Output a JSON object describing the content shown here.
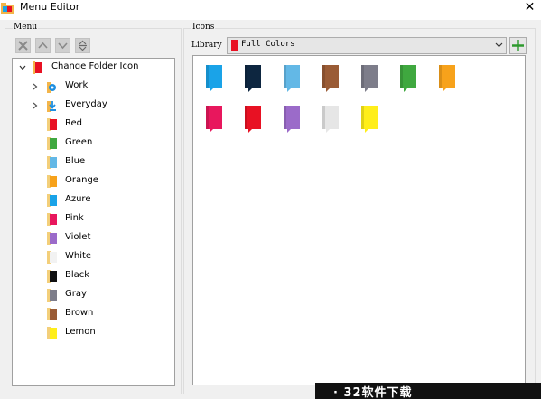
{
  "window": {
    "title": "Menu Editor",
    "close_glyph": "✕"
  },
  "menu_group": {
    "label": "Menu"
  },
  "icons_group": {
    "label": "Icons"
  },
  "toolbar": {
    "icons": [
      "delete-icon",
      "move-up-icon",
      "move-down-icon",
      "reorder-icon"
    ]
  },
  "tree": {
    "root": {
      "label": "Change Folder Icon",
      "color": "#e81123"
    },
    "items": [
      {
        "label": "Work",
        "icon": "gear-icon",
        "expandable": true
      },
      {
        "label": "Everyday",
        "icon": "download-icon",
        "expandable": true
      },
      {
        "label": "Red",
        "color": "#e81123"
      },
      {
        "label": "Green",
        "color": "#3fa83f"
      },
      {
        "label": "Blue",
        "color": "#63b8e6"
      },
      {
        "label": "Orange",
        "color": "#f7a21b"
      },
      {
        "label": "Azure",
        "color": "#1aa3e8"
      },
      {
        "label": "Pink",
        "color": "#e8175d"
      },
      {
        "label": "Violet",
        "color": "#9b6bc9"
      },
      {
        "label": "White",
        "color": "#f2f2f2"
      },
      {
        "label": "Black",
        "color": "#101010"
      },
      {
        "label": "Gray",
        "color": "#7d7d8a"
      },
      {
        "label": "Brown",
        "color": "#9a5b35"
      },
      {
        "label": "Lemon",
        "color": "#ffee1a"
      }
    ]
  },
  "library": {
    "label": "Library",
    "selected": "Full Colors",
    "color": "#e81123"
  },
  "icon_grid": [
    {
      "name": "folder-azure-icon",
      "color": "#1aa3e8"
    },
    {
      "name": "folder-navy-icon",
      "color": "#0d2640"
    },
    {
      "name": "folder-blue-icon",
      "color": "#63b8e6"
    },
    {
      "name": "folder-brown-icon",
      "color": "#9a5b35"
    },
    {
      "name": "folder-gray-icon",
      "color": "#7d7d8a"
    },
    {
      "name": "folder-green-icon",
      "color": "#3fa83f"
    },
    {
      "name": "folder-orange-icon",
      "color": "#f7a21b"
    },
    {
      "name": "folder-pink-icon",
      "color": "#e8175d"
    },
    {
      "name": "folder-red-icon",
      "color": "#e81123"
    },
    {
      "name": "folder-violet-icon",
      "color": "#9b6bc9"
    },
    {
      "name": "folder-white-icon",
      "color": "#e6e6e6"
    },
    {
      "name": "folder-lemon-icon",
      "color": "#ffee1a"
    }
  ],
  "watermark": {
    "text": "· 32软件下载"
  }
}
